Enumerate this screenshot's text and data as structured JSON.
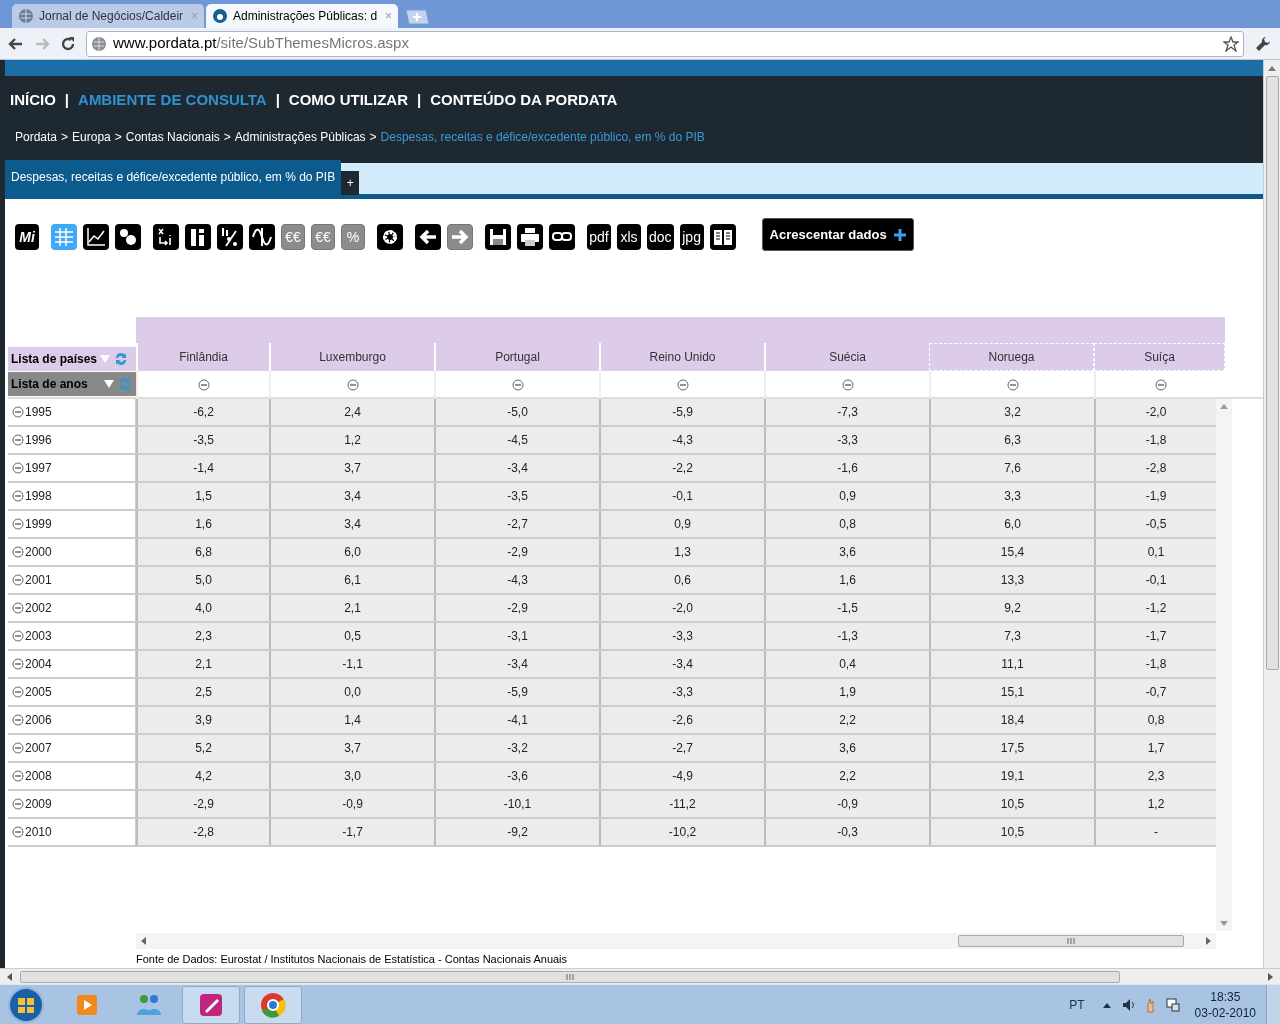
{
  "browser": {
    "tabs": [
      {
        "title": "Jornal de Negócios/Caldeir",
        "close": "×",
        "selected": false
      },
      {
        "title": "Administrações Públicas: d",
        "close": "×",
        "selected": true
      }
    ],
    "url": {
      "host": "www.pordata.pt",
      "path": "/site/SubThemesMicros.aspx"
    }
  },
  "site_nav": [
    {
      "kind": "link",
      "label": "INÍCIO",
      "selected": false
    },
    {
      "kind": "separator",
      "label": "|"
    },
    {
      "kind": "link",
      "label": "AMBIENTE DE CONSULTA",
      "selected": true
    },
    {
      "kind": "separator",
      "label": "|"
    },
    {
      "kind": "link",
      "label": "COMO UTILIZAR",
      "selected": false
    },
    {
      "kind": "separator",
      "label": "|"
    },
    {
      "kind": "link",
      "label": "CONTEÚDO DA PORDATA",
      "selected": false
    }
  ],
  "breadcrumb": [
    {
      "kind": "link",
      "label": "Pordata",
      "current": false
    },
    {
      "kind": "separator",
      "label": ">"
    },
    {
      "kind": "link",
      "label": "Europa",
      "current": false
    },
    {
      "kind": "separator",
      "label": ">"
    },
    {
      "kind": "link",
      "label": "Contas Nacionais",
      "current": false
    },
    {
      "kind": "separator",
      "label": ">"
    },
    {
      "kind": "link",
      "label": "Administrações Públicas",
      "current": false
    },
    {
      "kind": "separator",
      "label": ">"
    },
    {
      "kind": "link",
      "label": "Despesas, receitas e défice/excedente público, em % do PIB",
      "current": true
    }
  ],
  "page_tab": {
    "label": "Despesas, receitas e défice/excedente público, em % do PIB",
    "add": "+"
  },
  "toolbar": [
    [
      {
        "kind": "text",
        "label": "Mi",
        "selected": false,
        "disabled": false
      }
    ],
    [
      {
        "kind": "grid",
        "selected": true,
        "disabled": false
      },
      {
        "kind": "line-chart",
        "selected": false,
        "disabled": false
      },
      {
        "kind": "bubbles",
        "selected": false,
        "disabled": false
      }
    ],
    [
      {
        "kind": "swap",
        "selected": false,
        "disabled": false
      },
      {
        "kind": "columns",
        "selected": false,
        "disabled": false
      },
      {
        "kind": "bars-percent",
        "selected": false,
        "disabled": false
      },
      {
        "kind": "wave",
        "selected": false,
        "disabled": false
      },
      {
        "kind": "text",
        "label": "€€",
        "selected": false,
        "disabled": true
      },
      {
        "kind": "text",
        "label": "€€",
        "selected": false,
        "disabled": true
      },
      {
        "kind": "text",
        "label": "%",
        "selected": false,
        "disabled": true
      }
    ],
    [
      {
        "kind": "gear",
        "selected": false,
        "disabled": false
      }
    ],
    [
      {
        "kind": "arrow-left",
        "selected": false,
        "disabled": false
      },
      {
        "kind": "arrow-right",
        "selected": false,
        "disabled": true
      }
    ],
    [
      {
        "kind": "save",
        "selected": false,
        "disabled": false
      },
      {
        "kind": "print",
        "selected": false,
        "disabled": false
      },
      {
        "kind": "link",
        "selected": false,
        "disabled": false
      }
    ],
    [
      {
        "kind": "text",
        "label": "pdf",
        "selected": false,
        "disabled": false
      },
      {
        "kind": "text",
        "label": "xls",
        "selected": false,
        "disabled": false
      },
      {
        "kind": "text",
        "label": "doc",
        "selected": false,
        "disabled": false
      },
      {
        "kind": "text",
        "label": "jpg",
        "selected": false,
        "disabled": false
      },
      {
        "kind": "book",
        "selected": false,
        "disabled": false
      }
    ]
  ],
  "add_data_button": {
    "label": "Acrescentar dados"
  },
  "table": {
    "filters": [
      "Lista de países",
      "Lista de anos"
    ],
    "columns": [
      {
        "name": "Finlândia",
        "marked": false
      },
      {
        "name": "Luxemburgo",
        "marked": false
      },
      {
        "name": "Portugal",
        "marked": false
      },
      {
        "name": "Reino Unido",
        "marked": false
      },
      {
        "name": "Suécia",
        "marked": false
      },
      {
        "name": "Noruega",
        "marked": true
      },
      {
        "name": "Suíça",
        "marked": true
      }
    ],
    "rows": [
      {
        "year": "1995",
        "values": [
          "-6,2",
          "2,4",
          "-5,0",
          "-5,9",
          "-7,3",
          "3,2",
          "-2,0"
        ]
      },
      {
        "year": "1996",
        "values": [
          "-3,5",
          "1,2",
          "-4,5",
          "-4,3",
          "-3,3",
          "6,3",
          "-1,8"
        ]
      },
      {
        "year": "1997",
        "values": [
          "-1,4",
          "3,7",
          "-3,4",
          "-2,2",
          "-1,6",
          "7,6",
          "-2,8"
        ]
      },
      {
        "year": "1998",
        "values": [
          "1,5",
          "3,4",
          "-3,5",
          "-0,1",
          "0,9",
          "3,3",
          "-1,9"
        ]
      },
      {
        "year": "1999",
        "values": [
          "1,6",
          "3,4",
          "-2,7",
          "0,9",
          "0,8",
          "6,0",
          "-0,5"
        ]
      },
      {
        "year": "2000",
        "values": [
          "6,8",
          "6,0",
          "-2,9",
          "1,3",
          "3,6",
          "15,4",
          "0,1"
        ]
      },
      {
        "year": "2001",
        "values": [
          "5,0",
          "6,1",
          "-4,3",
          "0,6",
          "1,6",
          "13,3",
          "-0,1"
        ]
      },
      {
        "year": "2002",
        "values": [
          "4,0",
          "2,1",
          "-2,9",
          "-2,0",
          "-1,5",
          "9,2",
          "-1,2"
        ]
      },
      {
        "year": "2003",
        "values": [
          "2,3",
          "0,5",
          "-3,1",
          "-3,3",
          "-1,3",
          "7,3",
          "-1,7"
        ]
      },
      {
        "year": "2004",
        "values": [
          "2,1",
          "-1,1",
          "-3,4",
          "-3,4",
          "0,4",
          "11,1",
          "-1,8"
        ]
      },
      {
        "year": "2005",
        "values": [
          "2,5",
          "0,0",
          "-5,9",
          "-3,3",
          "1,9",
          "15,1",
          "-0,7"
        ]
      },
      {
        "year": "2006",
        "values": [
          "3,9",
          "1,4",
          "-4,1",
          "-2,6",
          "2,2",
          "18,4",
          "0,8"
        ]
      },
      {
        "year": "2007",
        "values": [
          "5,2",
          "3,7",
          "-3,2",
          "-2,7",
          "3,6",
          "17,5",
          "1,7"
        ]
      },
      {
        "year": "2008",
        "values": [
          "4,2",
          "3,0",
          "-3,6",
          "-4,9",
          "2,2",
          "19,1",
          "2,3"
        ]
      },
      {
        "year": "2009",
        "values": [
          "-2,9",
          "-0,9",
          "-10,1",
          "-11,2",
          "-0,9",
          "10,5",
          "1,2"
        ]
      },
      {
        "year": "2010",
        "values": [
          "-2,8",
          "-1,7",
          "-9,2",
          "-10,2",
          "-0,3",
          "10,5",
          "-"
        ]
      }
    ]
  },
  "source": "Fonte de Dados: Eurostat / Institutos Nacionais de Estatística - Contas Nacionais Anuais",
  "taskbar": {
    "apps": [
      {
        "kind": "media",
        "selected": false
      },
      {
        "kind": "people",
        "selected": false
      },
      {
        "kind": "pen",
        "selected": true
      },
      {
        "kind": "chrome",
        "selected": true
      }
    ],
    "language": "PT",
    "time": "18:35",
    "date": "03-02-2010"
  }
}
